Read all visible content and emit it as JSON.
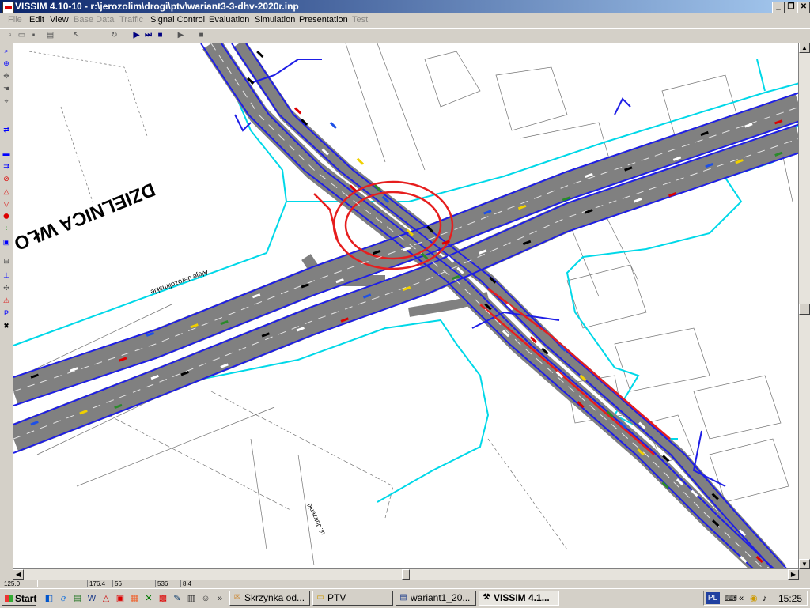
{
  "window": {
    "title": "VISSIM 4.10-10 - r:\\jerozolim\\drogi\\ptv\\wariant3-3-dhv-2020r.inp",
    "minimize_label": "_",
    "restore_label": "❐",
    "close_label": "✕"
  },
  "menu": [
    {
      "label": "File",
      "enabled": false
    },
    {
      "label": "Edit",
      "enabled": true
    },
    {
      "label": "View",
      "enabled": true
    },
    {
      "label": "Base Data",
      "enabled": false
    },
    {
      "label": "Traffic",
      "enabled": false
    },
    {
      "label": "Signal Control",
      "enabled": true
    },
    {
      "label": "Evaluation",
      "enabled": true
    },
    {
      "label": "Simulation",
      "enabled": true
    },
    {
      "label": "Presentation",
      "enabled": true
    },
    {
      "label": "Test",
      "enabled": false
    }
  ],
  "toolbar_icons": [
    "new-icon",
    "open-icon",
    "save-icon",
    "print-icon",
    "select-icon",
    "rotate-icon",
    "run-icon",
    "step-icon",
    "stop-icon",
    "play-icon",
    "pause-icon"
  ],
  "map": {
    "district_label": "DZIELNICA WŁO",
    "street_label_1": "Aleje Jerozolimskie",
    "street_label_2": "ul. Jutrzenki",
    "colors": {
      "road": "#808080",
      "link_edge": "#1e1ee6",
      "connector": "#e61e1e",
      "boundary": "#00d8e8",
      "background": "#ffffff"
    }
  },
  "statusbar": {
    "zoom": "125.0",
    "x": "176.4",
    "y": "56",
    "w": "536",
    "h": "8.4"
  },
  "taskbar": {
    "start_label": "Start",
    "tasks": [
      {
        "label": "Skrzynka od...",
        "icon": "mail-icon",
        "active": false
      },
      {
        "label": "PTV",
        "icon": "folder-icon",
        "active": false
      },
      {
        "label": "wariant1_20...",
        "icon": "document-icon",
        "active": false
      },
      {
        "label": "VISSIM 4.1...",
        "icon": "vissim-icon",
        "active": true
      }
    ],
    "language": "PL",
    "clock": "15:25"
  }
}
